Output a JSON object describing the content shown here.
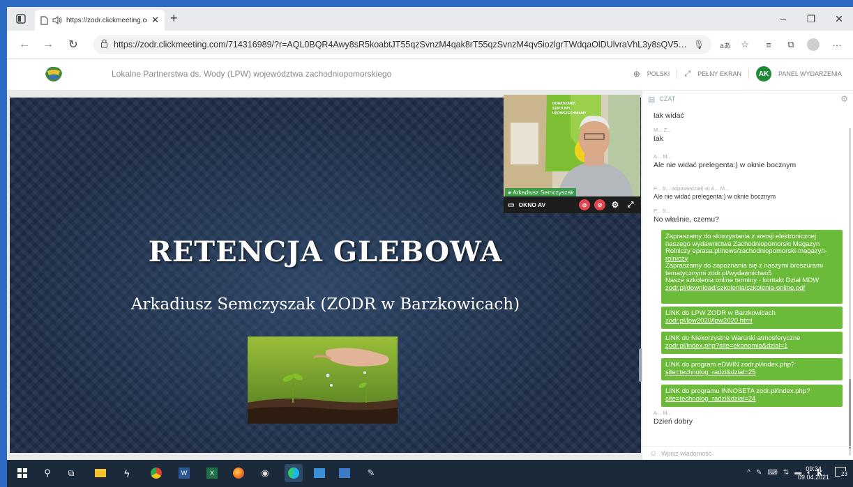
{
  "browser": {
    "tab_title": "https://zodr.clickmeeting.co",
    "url": "https://zodr.clickmeeting.com/714316989/?r=AQL0BQR4Awy8sR5koabtJT55qzSvnzM4qak8rT55qzSvnzM4qv5iozlgrTWdqaOlDUlvraVhL3y8sQV5A..."
  },
  "header": {
    "event_title": "Lokalne Partnerstwa ds. Wody (LPW) województwa zachodniopomorskiego",
    "language_label": "POLSKI",
    "fullscreen_label": "PEŁNY EKRAN",
    "avatar_initials": "AK",
    "panel_label": "PANEL WYDARZENIA"
  },
  "slide": {
    "title": "RETENCJA GLEBOWA",
    "subtitle": "Arkadiusz Semczyszak (ZODR w Barzkowicach)"
  },
  "video": {
    "presenter_name": "Arkadiusz Semczyszak",
    "window_label": "OKNO AV",
    "banner_text": "DORADZAMY, SZKOLIMY, UPOWSZECHNIAMY"
  },
  "chat": {
    "title": "CZAT",
    "input_placeholder": "Wpisz wiadomość",
    "messages": [
      {
        "author": "",
        "text": "tak widać"
      },
      {
        "author": "M... Z...",
        "text": "tak"
      },
      {
        "author": "A... M...",
        "text": "Ale nie widać prelegenta:) w oknie bocznym"
      },
      {
        "author": "P... S... odpowiedział(-a) A... M...",
        "text": "Ale nie widać prelegenta:) w oknie bocznym"
      },
      {
        "author": "P... S...",
        "text": "No właśnie, czemu?"
      },
      {
        "author": "A... M...",
        "text": "Dzień dobry"
      }
    ],
    "green": [
      {
        "lines": [
          "Zapraszamy do skorzystania z wersji elektronicznej",
          "naszego wydawnictwa Zachodniopomorski Magazyn",
          "Rolniczy eprasa.pl/news/zachodniopomorski-magazyn-",
          "rolniczy",
          "Zapraszamy do zapoznania się z naszymi broszurami",
          "tematycznymi zodr.pl/wydawnictwo5",
          "Nasze szkolenia online terminy - kontakt Dział MDW",
          "zodr.pl/download/szkolenia/szkolenia-online.pdf"
        ]
      },
      {
        "lines": [
          "LINK do LPW ZODR w Barzkowicach",
          "zodr.pl/lpw2020/lpw2020.html"
        ]
      },
      {
        "lines": [
          "LINK do Niekorzystne Warunki atmosferyczne",
          "zodr.pl/index.php?site=ekonomia&dzial=1"
        ]
      },
      {
        "lines": [
          "LINK do program eDWIN zodr.pl/index.php?",
          "site=technolog_radzi&dzial=25"
        ]
      },
      {
        "lines": [
          "LINK do programu INNOSETA zodr.pl/index.php?",
          "site=technolog_radzi&dzial=24"
        ]
      }
    ]
  },
  "taskbar": {
    "time": "09:34",
    "date": "09.04.2021",
    "notification_count": "23"
  }
}
